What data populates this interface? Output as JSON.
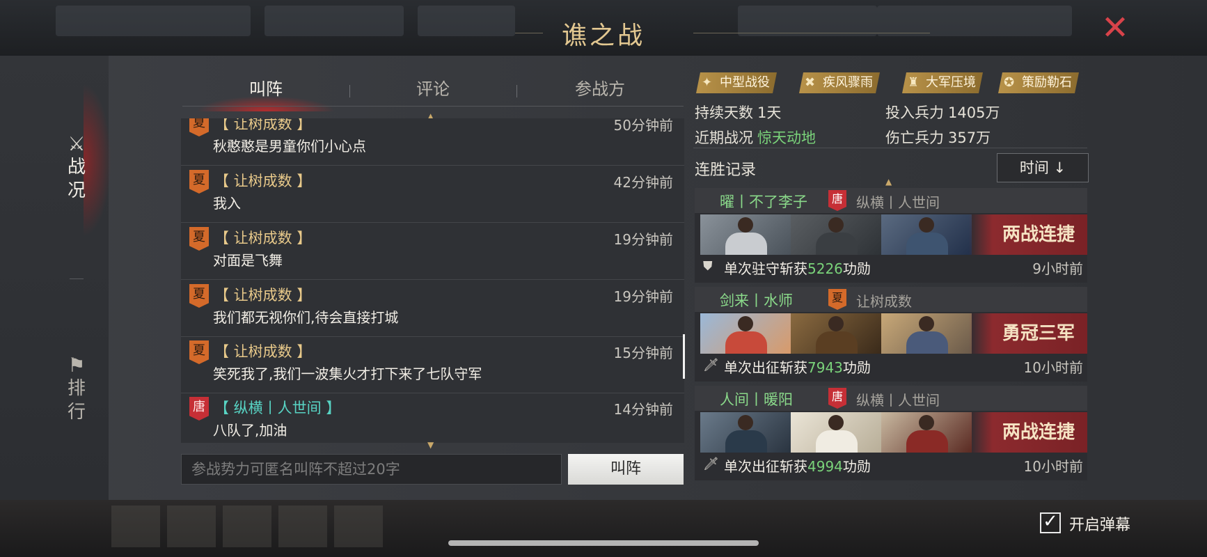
{
  "window": {
    "title": "谯之战"
  },
  "sidebar": {
    "items": [
      {
        "label": "战况",
        "icon": "crossed-swords-icon",
        "active": true
      },
      {
        "label": "排行",
        "icon": "flag-icon",
        "active": false
      }
    ]
  },
  "tabs": [
    {
      "label": "叫阵",
      "active": true
    },
    {
      "label": "评论",
      "active": false
    },
    {
      "label": "参战方",
      "active": false
    }
  ],
  "messages": [
    {
      "faction": "夏",
      "sender": "【 让树成数 】",
      "time": "50分钟前",
      "text": "秋憨憨是男童你们小心点"
    },
    {
      "faction": "夏",
      "sender": "【 让树成数 】",
      "time": "42分钟前",
      "text": "我入"
    },
    {
      "faction": "夏",
      "sender": "【 让树成数 】",
      "time": "19分钟前",
      "text": "对面是飞舞"
    },
    {
      "faction": "夏",
      "sender": "【 让树成数 】",
      "time": "19分钟前",
      "text": "我们都无视你们,待会直接打城"
    },
    {
      "faction": "夏",
      "sender": "【 让树成数 】",
      "time": "15分钟前",
      "text": "笑死我了,我们一波集火才打下来了七队守军"
    },
    {
      "faction": "唐",
      "sender": "【 纵横丨人世间 】",
      "time": "14分钟前",
      "text": "八队了,加油"
    }
  ],
  "chat_input": {
    "placeholder": "参战势力可匿名叫阵不超过20字",
    "send_label": "叫阵"
  },
  "battle_tags": [
    "中型战役",
    "疾风骤雨",
    "大军压境",
    "策励勒石"
  ],
  "stats": {
    "duration_label": "持续天数",
    "duration_value": "1天",
    "troops_label": "投入兵力",
    "troops_value": "1405万",
    "recent_label": "近期战况",
    "recent_value": "惊天动地",
    "casualties_label": "伤亡兵力",
    "casualties_value": "357万"
  },
  "streaks": {
    "title": "连胜记录",
    "sort_label": "时间 ↓",
    "records": [
      {
        "player": "曜丨不了李子",
        "opp_faction": "唐",
        "opponent": "纵横丨人世间",
        "stamp": "两战连捷",
        "desc_pre": "单次驻守斩获",
        "value": "5226",
        "desc_post": "功勋",
        "ago": "9小时前",
        "icon": "shield-icon"
      },
      {
        "player": "剑来丨水师",
        "opp_faction": "夏",
        "opponent": "让树成数",
        "stamp": "勇冠三军",
        "desc_pre": "单次出征斩获",
        "value": "7943",
        "desc_post": "功勋",
        "ago": "10小时前",
        "icon": "sword-icon"
      },
      {
        "player": "人间丨暖阳",
        "opp_faction": "唐",
        "opponent": "纵横丨人世间",
        "stamp": "两战连捷",
        "desc_pre": "单次出征斩获",
        "value": "4994",
        "desc_post": "功勋",
        "ago": "10小时前",
        "icon": "sword-icon"
      }
    ]
  },
  "danmu": {
    "label": "开启弹幕",
    "checked": true
  }
}
